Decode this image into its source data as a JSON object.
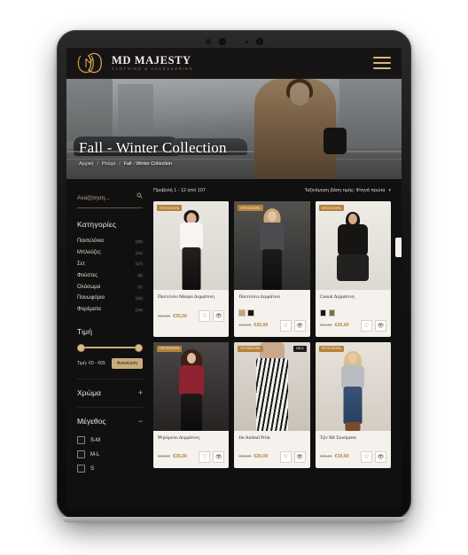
{
  "device": {
    "type": "tablet-mockup"
  },
  "header": {
    "brand_title": "MD MAJESTY",
    "brand_subtitle": "CLOTHING & ACCESSORIES",
    "menu_icon": "hamburger-menu-icon"
  },
  "hero": {
    "title": "Fall - Winter Collection",
    "breadcrumb": [
      {
        "label": "Αρχική"
      },
      {
        "label": "Ρούχα"
      },
      {
        "label": "Fall - Winter Collection"
      }
    ],
    "separator": "/"
  },
  "sidebar": {
    "search": {
      "placeholder": "Αναζήτηση...",
      "value": "",
      "icon": "search-icon"
    },
    "categories_title": "Κατηγορίες",
    "categories": [
      {
        "label": "Παντελόνια",
        "count": "(20)"
      },
      {
        "label": "Μπλούζες",
        "count": "(24)"
      },
      {
        "label": "Σετ",
        "count": "(17)"
      },
      {
        "label": "Φούστες",
        "count": "(8)"
      },
      {
        "label": "Ολόσωμα",
        "count": "(2)"
      },
      {
        "label": "Πανωφόρια",
        "count": "(20)"
      },
      {
        "label": "Φορέματα",
        "count": "(19)"
      }
    ],
    "price_title": "Τιμή",
    "price_label": "Τιμή: €0 - €65",
    "price_button": "Ανανέωση",
    "color_title": "Χρώμα",
    "color_sign": "+",
    "size_title": "Μέγεθος",
    "size_sign": "−",
    "sizes": [
      {
        "label": "S-M",
        "checked": false
      },
      {
        "label": "M-L",
        "checked": false
      },
      {
        "label": "S",
        "checked": false
      }
    ]
  },
  "toolbar": {
    "count": "Προβολή 1 - 12 από 107",
    "sort_label": "Ταξινόμηση βάση τιμής: Φτηνά πρώτα",
    "sort_icon": "chevron-down-icon"
  },
  "products": [
    {
      "title": "Παντελόνι Μαύρο Δερμάτινη",
      "badge": "ΠΡΟΣΦΟΡΑ",
      "badge_new": "",
      "old_price": "€30,00",
      "new_price": "€25,00",
      "swatches": [],
      "wishlist_icon": "heart-icon",
      "quickview_icon": "eye-icon"
    },
    {
      "title": "Παντελόνι Δερμάτινο",
      "badge": "ΠΡΟΣΦΟΡΑ",
      "badge_new": "",
      "old_price": "€45,00",
      "new_price": "€25,00",
      "swatches": [
        "#c2a578",
        "#171717"
      ],
      "wishlist_icon": "heart-icon",
      "quickview_icon": "eye-icon"
    },
    {
      "title": "Casual Δερμάτινη",
      "badge": "ΠΡΟΣΦΟΡΑ",
      "badge_new": "",
      "old_price": "€34,00",
      "new_price": "€20,00",
      "swatches": [
        "#171717",
        "#7b7348"
      ],
      "wishlist_icon": "heart-icon",
      "quickview_icon": "eye-icon"
    },
    {
      "title": "Ψηλόμεσο Δερμάτινη",
      "badge": "ΠΡΟΣΦΟΡΑ",
      "badge_new": "",
      "old_price": "€30,00",
      "new_price": "€25,00",
      "swatches": [],
      "wishlist_icon": "heart-icon",
      "quickview_icon": "eye-icon"
    },
    {
      "title": "Jin Animal Print",
      "badge": "ΠΡΟΣΦΟΡΑ",
      "badge_new": "ΝΕΟ",
      "old_price": "€35,00",
      "new_price": "€20,00",
      "swatches": [],
      "wishlist_icon": "heart-icon",
      "quickview_icon": "eye-icon"
    },
    {
      "title": "Τζιν Με Σκισίματα",
      "badge": "ΠΡΟΣΦΟΡΑ",
      "badge_new": "",
      "old_price": "€30,00",
      "new_price": "€19,90",
      "swatches": [],
      "wishlist_icon": "heart-icon",
      "quickview_icon": "eye-icon"
    }
  ],
  "colors": {
    "gold": "#c9ab7b",
    "badge_gold": "#b5823a",
    "page_dark": "#111010",
    "card_bg": "#f5f2ee"
  }
}
